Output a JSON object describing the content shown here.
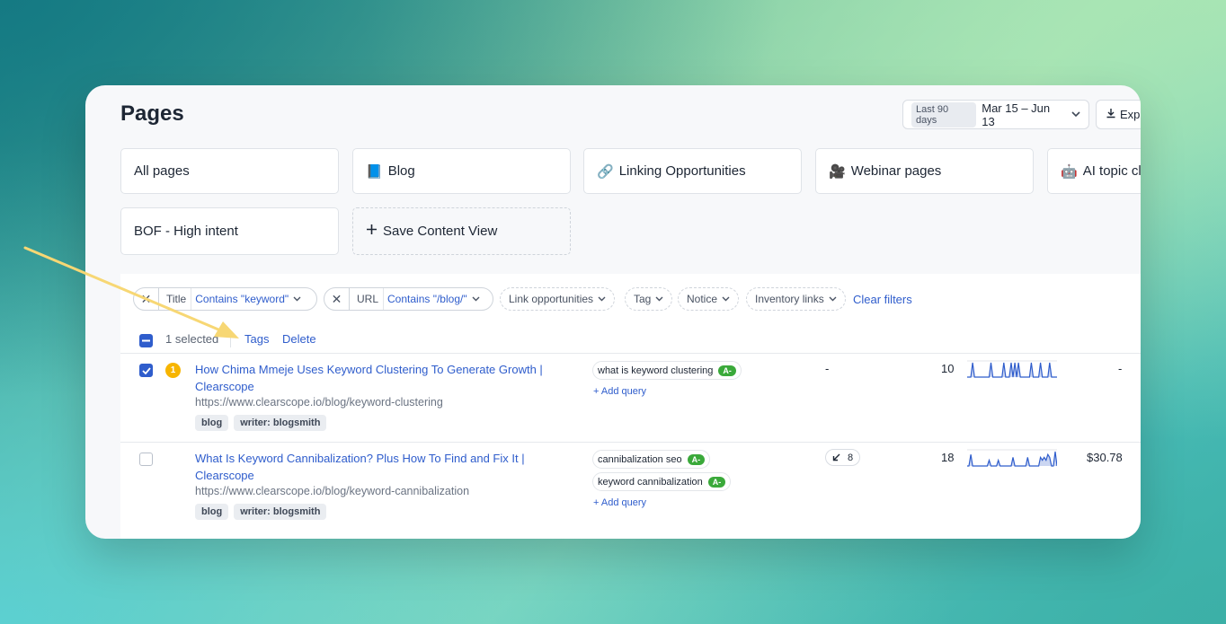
{
  "header": {
    "title": "Pages",
    "date_chip": "Last 90 days",
    "date_range": "Mar 15 – Jun 13",
    "export_label": "Exp"
  },
  "views": [
    {
      "icon": "",
      "label": "All pages"
    },
    {
      "icon": "📘",
      "label": "Blog"
    },
    {
      "icon": "🔗",
      "label": "Linking Opportunities"
    },
    {
      "icon": "🎥",
      "label": "Webinar pages"
    },
    {
      "icon": "🤖",
      "label": "AI topic clu"
    },
    {
      "icon": "",
      "label": "BOF - High intent"
    }
  ],
  "save_view_label": "Save Content View",
  "filters": {
    "title_field": "Title",
    "title_value": "Contains \"keyword\"",
    "url_field": "URL",
    "url_value": "Contains \"/blog/\"",
    "link_opportunities": "Link opportunities",
    "tag": "Tag",
    "notice": "Notice",
    "inventory_links": "Inventory links",
    "clear": "Clear filters"
  },
  "selection": {
    "count": "1 selected",
    "tags_action": "Tags",
    "delete_action": "Delete"
  },
  "rows": [
    {
      "checked": true,
      "notice": "1",
      "title": "How Chima Mmeje Uses Keyword Clustering To Generate Growth | Clearscope",
      "url": "https://www.clearscope.io/blog/keyword-clustering",
      "tags": [
        "blog",
        "writer: blogsmith"
      ],
      "queries": [
        {
          "text": "what is keyword clustering",
          "grade": "A-"
        }
      ],
      "add_query": "+ Add query",
      "links": "-",
      "count": "10",
      "value": "-",
      "trend": [
        0,
        0,
        0,
        3,
        0,
        0,
        0,
        0,
        0,
        0,
        0,
        0,
        0,
        3,
        0,
        0,
        0,
        0,
        0,
        0,
        3,
        0,
        0,
        0,
        3,
        0,
        3,
        0,
        3,
        0,
        0,
        0,
        0,
        0,
        0,
        3,
        0,
        0,
        0,
        0,
        3,
        0,
        0,
        0,
        0,
        3,
        0,
        0,
        0,
        0
      ]
    },
    {
      "checked": false,
      "notice": "",
      "title": "What Is Keyword Cannibalization? Plus How To Find and Fix It | Clearscope",
      "url": "https://www.clearscope.io/blog/keyword-cannibalization",
      "tags": [
        "blog",
        "writer: blogsmith"
      ],
      "queries": [
        {
          "text": "cannibalization seo",
          "grade": "A-"
        },
        {
          "text": "keyword cannibalization",
          "grade": "A-"
        }
      ],
      "add_query": "+ Add query",
      "links": "8",
      "count": "18",
      "value": "$30.78",
      "trend": [
        0,
        0,
        4,
        0,
        0,
        0,
        0,
        0,
        0,
        0,
        0,
        0,
        2,
        0,
        0,
        0,
        0,
        2,
        0,
        0,
        0,
        0,
        0,
        0,
        0,
        3,
        0,
        0,
        0,
        0,
        0,
        0,
        0,
        3,
        0,
        0,
        0,
        0,
        0,
        0,
        3,
        2,
        3,
        2,
        4,
        3,
        0,
        0,
        5,
        0
      ]
    }
  ]
}
